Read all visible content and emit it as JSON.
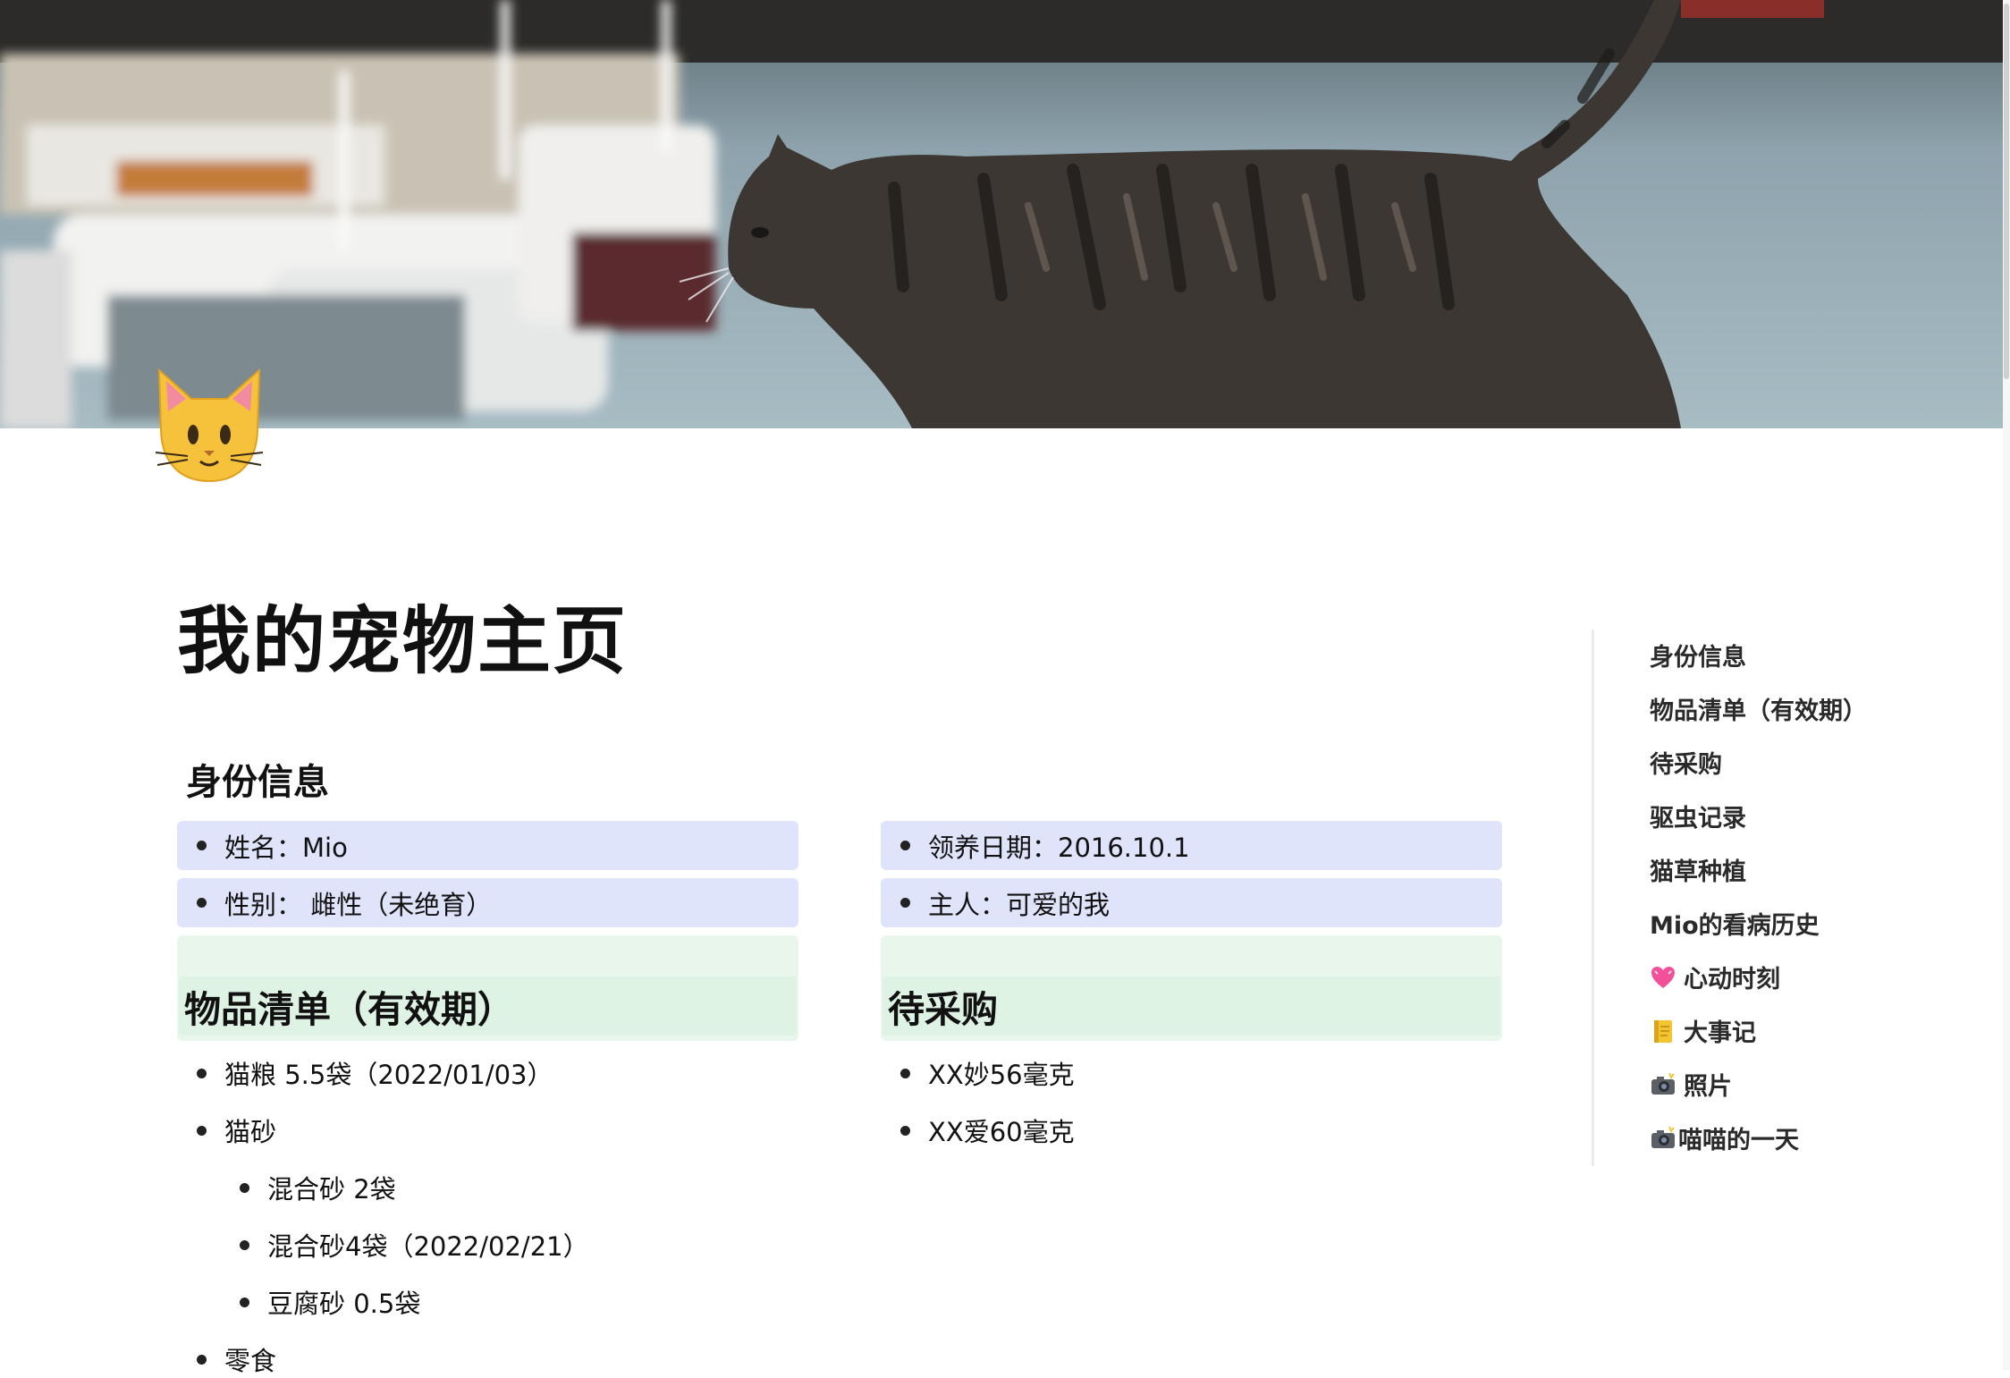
{
  "page": {
    "title": "我的宠物主页",
    "icon": "cat-face-icon"
  },
  "cover": {
    "image": "cat-walking-by-harbor"
  },
  "identity": {
    "heading": "身份信息",
    "left": [
      "姓名：Mio",
      "性别： 雌性（未绝育）"
    ],
    "right": [
      "领养日期：2016.10.1",
      "主人：可爱的我"
    ]
  },
  "items": {
    "heading": "物品清单（有效期）",
    "list": [
      {
        "text": "猫粮 5.5袋（2022/01/03）",
        "level": 0
      },
      {
        "text": "猫砂",
        "level": 0
      },
      {
        "text": "混合砂 2袋",
        "level": 1
      },
      {
        "text": "混合砂4袋（2022/02/21）",
        "level": 1
      },
      {
        "text": "豆腐砂 0.5袋",
        "level": 1
      },
      {
        "text": "零食",
        "level": 0
      }
    ]
  },
  "shopping": {
    "heading": "待采购",
    "list": [
      "XX妙56毫克",
      "XX爱60毫克"
    ]
  },
  "toc": [
    {
      "label": "身份信息",
      "icon": ""
    },
    {
      "label": "物品清单（有效期）",
      "icon": ""
    },
    {
      "label": "待采购",
      "icon": ""
    },
    {
      "label": "驱虫记录",
      "icon": ""
    },
    {
      "label": "猫草种植",
      "icon": ""
    },
    {
      "label": "Mio的看病历史",
      "icon": ""
    },
    {
      "label": "心动时刻",
      "icon": "pink-heart-icon"
    },
    {
      "label": "大事记",
      "icon": "ledger-icon"
    },
    {
      "label": "照片",
      "icon": "camera-flash-icon"
    },
    {
      "label": "喵喵的一天",
      "icon": "camera-flash-icon"
    }
  ],
  "colors": {
    "identity_block": "#e0e4fb",
    "heading_block": "#e9f6ec",
    "heading_inner": "#def3e4"
  }
}
